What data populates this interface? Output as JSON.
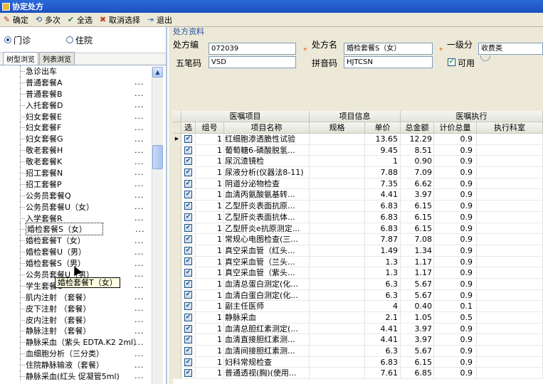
{
  "window": {
    "title": "协定处方"
  },
  "toolbar": {
    "items": [
      {
        "label": "确定",
        "icon": "pencil-icon"
      },
      {
        "label": "多次",
        "icon": "multi-icon"
      },
      {
        "label": "全选",
        "icon": "select-all-icon"
      },
      {
        "label": "取消选择",
        "icon": "deselect-icon"
      },
      {
        "label": "退出",
        "icon": "exit-icon"
      }
    ]
  },
  "left": {
    "radio": {
      "outpatient": "门诊",
      "inpatient": "住院",
      "selected": "门诊"
    },
    "tabs": [
      "树型浏览",
      "列表浏览"
    ],
    "tree": [
      {
        "label": "急诊出车",
        "dots": ""
      },
      {
        "label": "普通套餐A",
        "dots": "..."
      },
      {
        "label": "普通套餐B",
        "dots": "..."
      },
      {
        "label": "入托套餐D",
        "dots": "..."
      },
      {
        "label": "妇女套餐E",
        "dots": "..."
      },
      {
        "label": "妇女套餐F",
        "dots": "..."
      },
      {
        "label": "妇女套餐G",
        "dots": "..."
      },
      {
        "label": "敬老套餐H",
        "dots": "..."
      },
      {
        "label": "敬老套餐K",
        "dots": "..."
      },
      {
        "label": "招工套餐N",
        "dots": "..."
      },
      {
        "label": "招工套餐P",
        "dots": "..."
      },
      {
        "label": "公务员套餐Q",
        "dots": "..."
      },
      {
        "label": "公务员套餐U（女）",
        "dots": "..."
      },
      {
        "label": "入学套餐R",
        "dots": "..."
      },
      {
        "label": "婚检套餐S（女）",
        "dots": "...",
        "selected": true
      },
      {
        "label": "婚检套餐T（女）",
        "dots": "..."
      },
      {
        "label": "婚检套餐U（男）",
        "dots": "..."
      },
      {
        "label": "婚检套餐S（男）",
        "dots": "..."
      },
      {
        "label": "公务员套餐U（男）",
        "dots": "..."
      },
      {
        "label": "学生套餐C",
        "dots": "..."
      },
      {
        "label": "肌内注射 （套餐）",
        "dots": "..."
      },
      {
        "label": "皮下注射 （套餐）",
        "dots": "..."
      },
      {
        "label": "皮内注射 （套餐）",
        "dots": "..."
      },
      {
        "label": "静脉注射 （套餐）",
        "dots": "..."
      },
      {
        "label": "静脉采血（紫头 EDTA.K2 2ml）",
        "dots": "..."
      },
      {
        "label": "血细胞分析（三分类）",
        "dots": "..."
      },
      {
        "label": "住院静脉输液（套餐）",
        "dots": "..."
      },
      {
        "label": "静脉采血(红头 促凝管5ml)",
        "dots": "..."
      }
    ],
    "tooltip": "婚检套餐T（女）"
  },
  "form": {
    "group_title": "处方资料",
    "code_label": "处方编",
    "code_value": "072039",
    "name_label": "处方名",
    "name_value": "婚检套餐S（女）",
    "level_label": "一级分",
    "level_value": "收费类",
    "wubi_label": "五笔码",
    "wubi_value": "VSD",
    "pinyin_label": "拼音码",
    "pinyin_value": "HJTCSN",
    "enabled_label": "可用",
    "enabled": true
  },
  "grid": {
    "groups": [
      "医嘱项目",
      "项目信息",
      "医嘱执行"
    ],
    "columns": [
      "选",
      "组号",
      "项目名称",
      "规格",
      "单价",
      "总金额",
      "计价总量",
      "执行科室"
    ],
    "rows": [
      {
        "group": "1",
        "name": "红细胞渗透脆性试验",
        "spec": "",
        "price": "13.65",
        "total": "12.29",
        "qty": "0.9",
        "dept": ""
      },
      {
        "group": "1",
        "name": "葡萄糖6-磷酸脱氢...",
        "spec": "",
        "price": "9.45",
        "total": "8.51",
        "qty": "0.9",
        "dept": ""
      },
      {
        "group": "1",
        "name": "尿沉渣镜检",
        "spec": "",
        "price": "1",
        "total": "0.90",
        "qty": "0.9",
        "dept": ""
      },
      {
        "group": "1",
        "name": "尿液分析(仪器法8-11)",
        "spec": "",
        "price": "7.88",
        "total": "7.09",
        "qty": "0.9",
        "dept": ""
      },
      {
        "group": "1",
        "name": "阴道分泌物检查",
        "spec": "",
        "price": "7.35",
        "total": "6.62",
        "qty": "0.9",
        "dept": ""
      },
      {
        "group": "1",
        "name": "血清丙氨酸氨基转...",
        "spec": "",
        "price": "4.41",
        "total": "3.97",
        "qty": "0.9",
        "dept": ""
      },
      {
        "group": "1",
        "name": "乙型肝炎表面抗原...",
        "spec": "",
        "price": "6.83",
        "total": "6.15",
        "qty": "0.9",
        "dept": ""
      },
      {
        "group": "1",
        "name": "乙型肝炎表面抗体...",
        "spec": "",
        "price": "6.83",
        "total": "6.15",
        "qty": "0.9",
        "dept": ""
      },
      {
        "group": "1",
        "name": "乙型肝炎e抗原测定...",
        "spec": "",
        "price": "6.83",
        "total": "6.15",
        "qty": "0.9",
        "dept": ""
      },
      {
        "group": "1",
        "name": "常规心电图检查(三...",
        "spec": "",
        "price": "7.87",
        "total": "7.08",
        "qty": "0.9",
        "dept": ""
      },
      {
        "group": "1",
        "name": "真空采血管（红头...",
        "spec": "",
        "price": "1.49",
        "total": "1.34",
        "qty": "0.9",
        "dept": ""
      },
      {
        "group": "1",
        "name": "真空采血管（兰头...",
        "spec": "",
        "price": "1.3",
        "total": "1.17",
        "qty": "0.9",
        "dept": ""
      },
      {
        "group": "1",
        "name": "真空采血管（紫头...",
        "spec": "",
        "price": "1.3",
        "total": "1.17",
        "qty": "0.9",
        "dept": ""
      },
      {
        "group": "1",
        "name": "血清总蛋白测定(化...",
        "spec": "",
        "price": "6.3",
        "total": "5.67",
        "qty": "0.9",
        "dept": ""
      },
      {
        "group": "1",
        "name": "血清白蛋白测定(化...",
        "spec": "",
        "price": "6.3",
        "total": "5.67",
        "qty": "0.9",
        "dept": ""
      },
      {
        "group": "1",
        "name": "副主任医师",
        "spec": "",
        "price": "4",
        "total": "0.40",
        "qty": "0.1",
        "dept": ""
      },
      {
        "group": "1",
        "name": "静脉采血",
        "spec": "",
        "price": "2.1",
        "total": "1.05",
        "qty": "0.5",
        "dept": ""
      },
      {
        "group": "1",
        "name": "血清总胆红素测定(...",
        "spec": "",
        "price": "4.41",
        "total": "3.97",
        "qty": "0.9",
        "dept": ""
      },
      {
        "group": "1",
        "name": "血清直接胆红素测...",
        "spec": "",
        "price": "4.41",
        "total": "3.97",
        "qty": "0.9",
        "dept": ""
      },
      {
        "group": "1",
        "name": "血清间接胆红素测...",
        "spec": "",
        "price": "6.3",
        "total": "5.67",
        "qty": "0.9",
        "dept": ""
      },
      {
        "group": "1",
        "name": "妇科常规检查",
        "spec": "",
        "price": "6.83",
        "total": "6.15",
        "qty": "0.9",
        "dept": ""
      },
      {
        "group": "1",
        "name": "普通透视(胸)(使用...",
        "spec": "",
        "price": "7.61",
        "total": "6.85",
        "qty": "0.9",
        "dept": ""
      }
    ]
  }
}
